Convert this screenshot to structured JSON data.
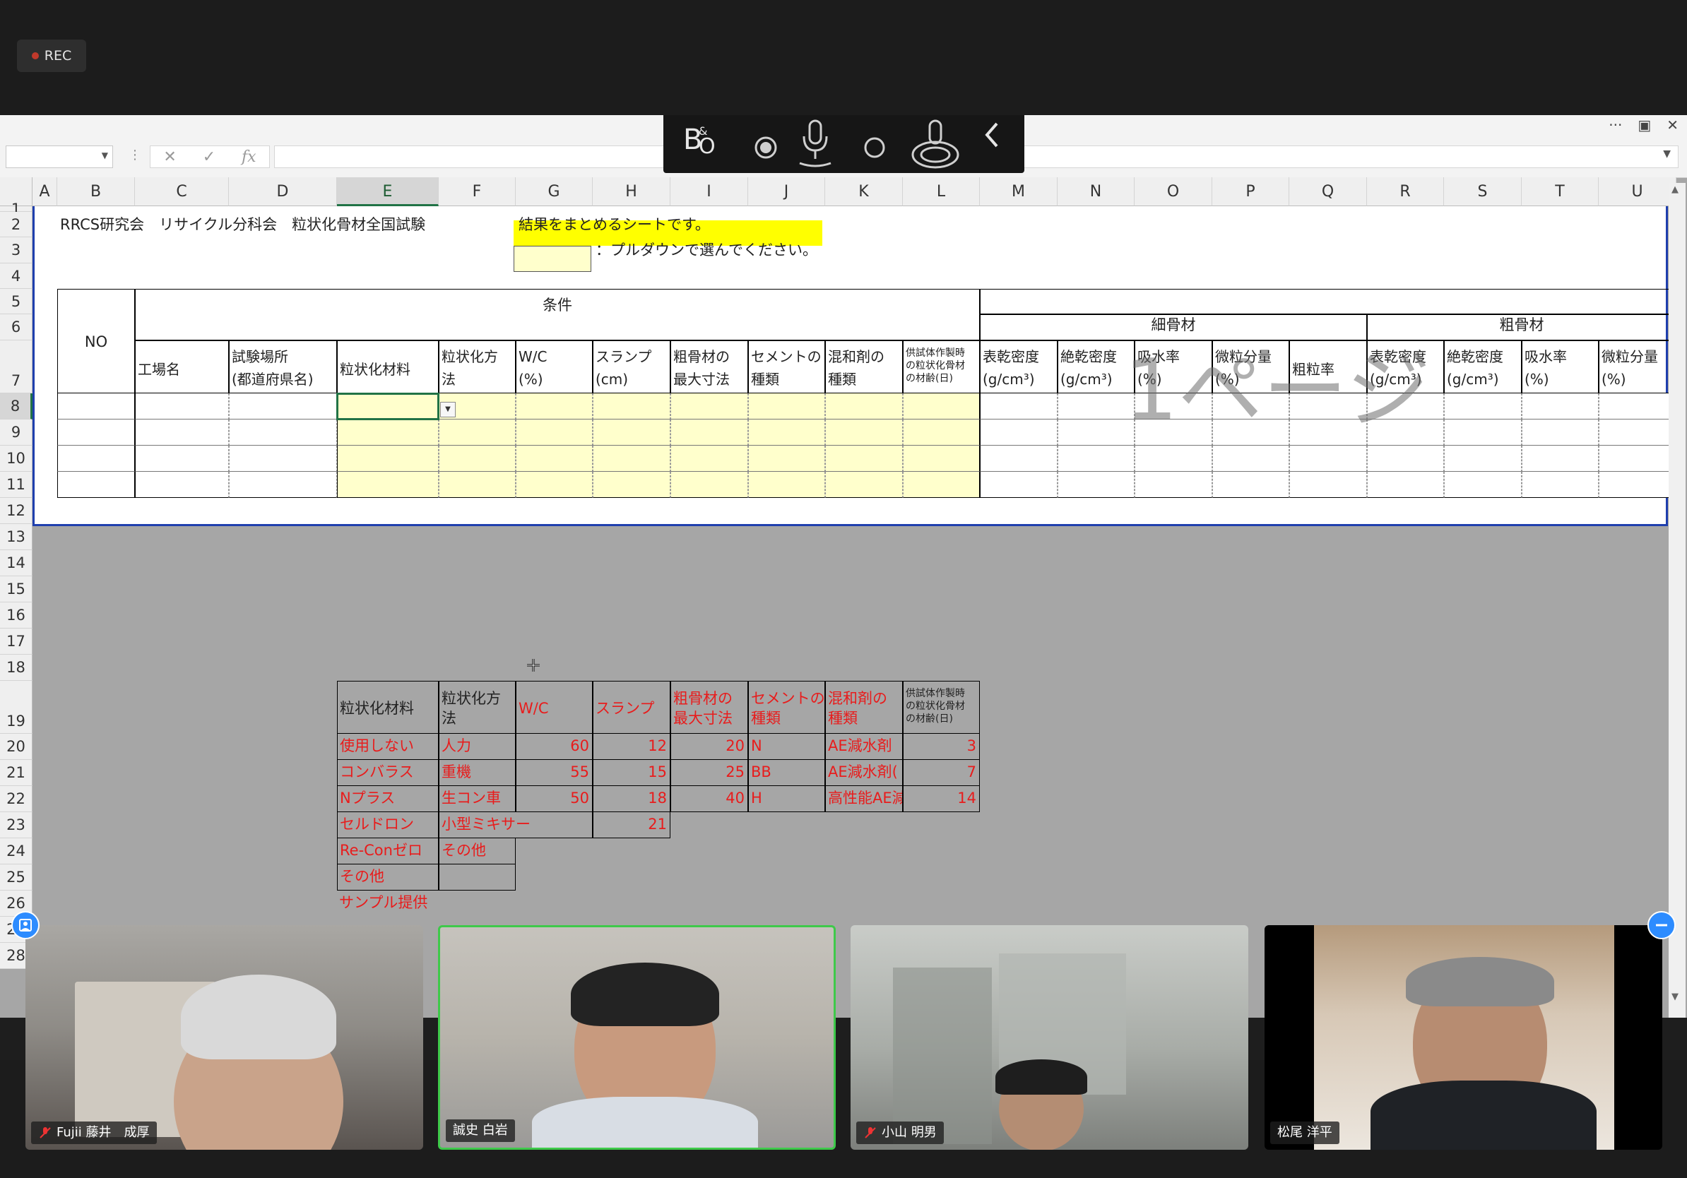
{
  "recording": {
    "label": "REC"
  },
  "column_letters": [
    "A",
    "B",
    "C",
    "D",
    "E",
    "F",
    "G",
    "H",
    "I",
    "J",
    "K",
    "L",
    "M",
    "N",
    "O",
    "P",
    "Q",
    "R",
    "S",
    "T",
    "U"
  ],
  "row_numbers": [
    "1",
    "2",
    "3",
    "4",
    "5",
    "6",
    "7",
    "8",
    "9",
    "10",
    "11",
    "12",
    "13",
    "14",
    "15",
    "16",
    "17",
    "18",
    "19",
    "20",
    "21",
    "22",
    "23",
    "24",
    "25",
    "26",
    "27",
    "28"
  ],
  "sheet": {
    "title": "RRCS研究会　リサイクル分科会　粒状化骨材全国試験",
    "note_highlight": "結果をまとめるシートです。",
    "pulldown_note": "：プルダウンで選んでください。",
    "header_no": "NO",
    "header_conditions": "条件",
    "header_fine": "細骨材",
    "header_coarse": "粗骨材",
    "page_watermark": "1ページ",
    "col_factory": "工場名",
    "col_site_1": "試験場所",
    "col_site_2": "(都道府県名)",
    "col_material": "粒状化材料",
    "col_method_1": "粒状化方",
    "col_method_2": "法",
    "col_wc_1": "W/C",
    "col_wc_2": "(%)",
    "col_slump_1": "スランプ",
    "col_slump_2": "(cm)",
    "col_maxsize_1": "粗骨材の",
    "col_maxsize_2": "最大寸法",
    "col_cement_1": "セメントの",
    "col_cement_2": "種類",
    "col_admix_1": "混和剤の",
    "col_admix_2": "種類",
    "col_age_1": "供試体作製時",
    "col_age_2": "の粒状化骨材",
    "col_age_3": "の材齢(日)",
    "col_surface_density": "表乾密度",
    "col_abs_density": "絶乾密度",
    "col_absorption": "吸水率",
    "col_fines": "微粒分量",
    "col_fineness": "粗粒率",
    "unit_density": "(g/cm³)",
    "unit_percent": "(%)"
  },
  "lookup": {
    "header_material": "粒状化材料",
    "header_method_1": "粒状化方",
    "header_method_2": "法",
    "header_wc": "W/C",
    "header_slump": "スランプ",
    "header_maxsize_1": "粗骨材の",
    "header_maxsize_2": "最大寸法",
    "header_cement_1": "セメントの",
    "header_cement_2": "種類",
    "header_admix_1": "混和剤の",
    "header_admix_2": "種類",
    "header_age_1": "供試体作製時",
    "header_age_2": "の粒状化骨材",
    "header_age_3": "の材齢(日)",
    "materials": [
      "使用しない",
      "コンバラス",
      "Nプラス",
      "セルドロン",
      "Re-Conゼロ",
      "その他",
      "サンプル提供"
    ],
    "methods": [
      "人力",
      "重機",
      "生コン車",
      "小型ミキサー",
      "その他"
    ],
    "wc": [
      "60",
      "55",
      "50"
    ],
    "slump": [
      "12",
      "15",
      "18",
      "21"
    ],
    "maxsize": [
      "20",
      "25",
      "40"
    ],
    "cement": [
      "N",
      "BB",
      "H"
    ],
    "admix": [
      "AE減水剤",
      "AE減水剤(",
      "高性能AE減"
    ],
    "age": [
      "3",
      "7",
      "14"
    ]
  },
  "participants": [
    {
      "name": "Fujii 藤井　成厚",
      "muted": true,
      "active": false
    },
    {
      "name": "誠史 白岩",
      "muted": false,
      "active": true
    },
    {
      "name": "小山 明男",
      "muted": true,
      "active": false
    },
    {
      "name": "松尾 洋平",
      "muted": false,
      "active": false
    }
  ],
  "colors": {
    "yellow_note": "#ffff00",
    "input_fill": "#ffffcc",
    "print_border": "#1f3fae",
    "lookup_red": "#e81c1c",
    "active_speaker": "#3ec94a"
  },
  "icons": [
    "record-dot",
    "bo-logo",
    "record-button",
    "microphone-icon",
    "circle-button",
    "microphone-waves-icon",
    "chevron-left-icon",
    "cancel-icon",
    "confirm-icon",
    "function-icon",
    "dropdown-arrow-icon",
    "move-cursor-icon",
    "microphone-muted-icon",
    "avatar-icon",
    "minimize-icon"
  ]
}
